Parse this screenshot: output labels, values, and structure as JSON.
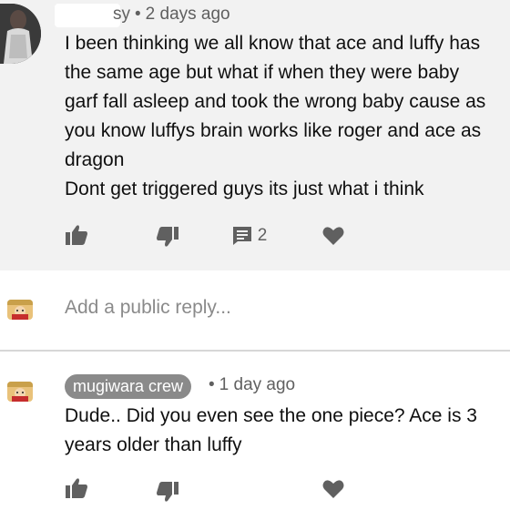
{
  "comment": {
    "author_visible": "sy",
    "timestamp": "2 days ago",
    "lines": [
      "I been thinking we all know that ace and luffy has",
      "the same age but what if when they were baby",
      "garf fall asleep and took the wrong baby cause as",
      "you know luffys brain works like roger and ace as",
      "dragon",
      "Dont get triggered guys its just what i think"
    ],
    "reply_count": "2"
  },
  "reply_box": {
    "placeholder": "Add a public reply..."
  },
  "reply": {
    "author": "mugiwara crew",
    "timestamp": "1 day ago",
    "lines": [
      "Dude.. Did you even see the one piece? Ace is 3",
      "years older than luffy"
    ]
  },
  "separator": "•",
  "icons": {
    "like": "thumbs-up-icon",
    "dislike": "thumbs-down-icon",
    "reply": "reply-comment-icon",
    "heart": "heart-icon"
  },
  "colors": {
    "top_background": "#f2f2f2",
    "icon_gray": "#606060",
    "chip_gray": "#8a8a8a",
    "divider": "#d7d7d7"
  }
}
